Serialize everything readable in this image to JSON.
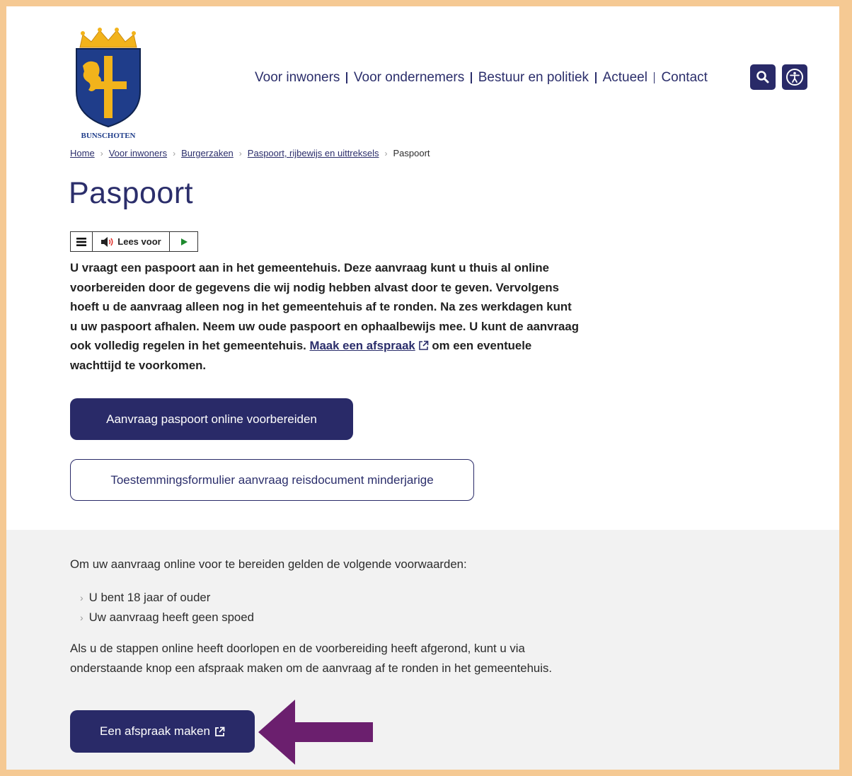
{
  "header": {
    "logo_text": "BUNSCHOTEN",
    "nav": [
      {
        "label": "Voor inwoners"
      },
      {
        "label": "Voor ondernemers"
      },
      {
        "label": "Bestuur en politiek"
      },
      {
        "label": "Actueel"
      },
      {
        "label": "Contact"
      }
    ],
    "search_icon": "search-icon",
    "accessibility_icon": "accessibility-icon"
  },
  "breadcrumb": [
    {
      "label": "Home"
    },
    {
      "label": "Voor inwoners"
    },
    {
      "label": "Burgerzaken"
    },
    {
      "label": "Paspoort, rijbewijs en uittreksels"
    },
    {
      "label": "Paspoort"
    }
  ],
  "page": {
    "title": "Paspoort",
    "read_aloud_label": "Lees voor",
    "intro_text": "U vraagt een paspoort aan in het gemeentehuis. Deze aanvraag kunt u thuis al online voorbereiden door de gegevens die wij nodig hebben alvast door te geven. Vervolgens hoeft u de aanvraag alleen nog in het gemeentehuis af te ronden. Na zes werkdagen kunt u uw paspoort afhalen. Neem uw oude paspoort en ophaalbewijs mee. U kunt de aanvraag ook volledig regelen in het gemeentehuis. ",
    "intro_link": "Maak een afspraak",
    "intro_suffix": " om een eventuele wachttijd te voorkomen.",
    "primary_button": "Aanvraag paspoort online voorbereiden",
    "secondary_button": "Toestemmingsformulier aanvraag reisdocument minderjarige"
  },
  "conditions": {
    "intro": "Om uw aanvraag online voor te bereiden gelden de volgende voorwaarden:",
    "items": [
      {
        "label": "U bent 18 jaar of ouder"
      },
      {
        "label": "Uw aanvraag heeft geen spoed"
      }
    ],
    "after_text": "Als u de stappen online heeft doorlopen en de voorbereiding heeft afgerond, kunt u via onderstaande knop een afspraak maken om de aanvraag af te ronden in het gemeentehuis.",
    "appointment_button": "Een afspraak maken"
  },
  "colors": {
    "brand": "#292a68",
    "frame": "#f5c993",
    "arrow": "#6b1f6e",
    "grey_section": "#f2f2f2"
  }
}
